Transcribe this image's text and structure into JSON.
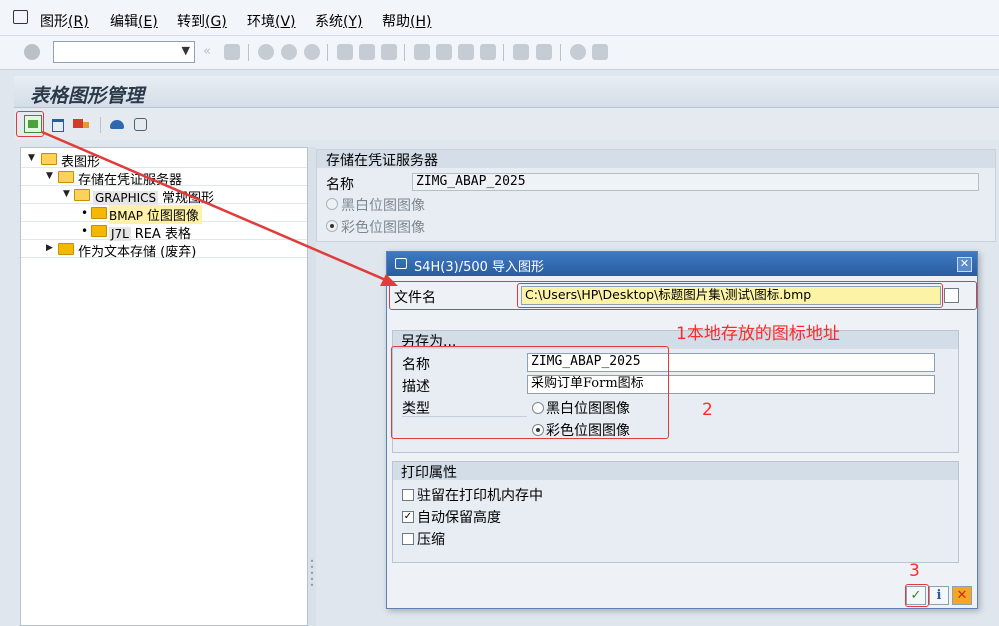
{
  "menu": {
    "items": [
      {
        "label": "图形",
        "key": "(R)"
      },
      {
        "label": "编辑",
        "key": "(E)"
      },
      {
        "label": "转到",
        "key": "(G)"
      },
      {
        "label": "环境",
        "key": "(V)"
      },
      {
        "label": "系统",
        "key": "(Y)"
      },
      {
        "label": "帮助",
        "key": "(H)"
      }
    ]
  },
  "toolbar": {
    "command_value": ""
  },
  "page": {
    "title": "表格图形管理"
  },
  "tree": {
    "root": "表图形",
    "server": "存储在凭证服务器",
    "graphics_tag": "GRAPHICS",
    "graphics_label": "常规图形",
    "bmap_tag": "BMAP",
    "bmap_label": "位图图像",
    "j7l_tag": "J7L",
    "j7l_label": "REA 表格",
    "text_store": "作为文本存储 (废弃)"
  },
  "right": {
    "group_title": "存储在凭证服务器",
    "name_label": "名称",
    "name_value": "ZIMG_ABAP_2025",
    "bw_label": "黑白位图图像",
    "color_label": "彩色位图图像"
  },
  "dialog": {
    "title": "S4H(3)/500 导入图形",
    "file_label": "文件名",
    "file_value": "C:\\Users\\HP\\Desktop\\标题图片集\\测试\\图标.bmp",
    "saveas_title": "另存为...",
    "name_label": "名称",
    "name_value": "ZIMG_ABAP_2025",
    "desc_label": "描述",
    "desc_value": "采购订单Form图标",
    "type_label": "类型",
    "bw_label": "黑白位图图像",
    "color_label": "彩色位图图像",
    "print_title": "打印属性",
    "opt1": "驻留在打印机内存中",
    "opt2": "自动保留高度",
    "opt3": "压缩",
    "btn_info": "i",
    "btn_cancel": "✕",
    "btn_ok": "✓"
  },
  "annotations": {
    "note1": "1本地存放的图标地址",
    "note2": "2",
    "note3": "3"
  },
  "colors": {
    "dialog_title": "#2a5d9f",
    "annotation": "#ff2a2a",
    "file_field": "#fdf3a6"
  }
}
